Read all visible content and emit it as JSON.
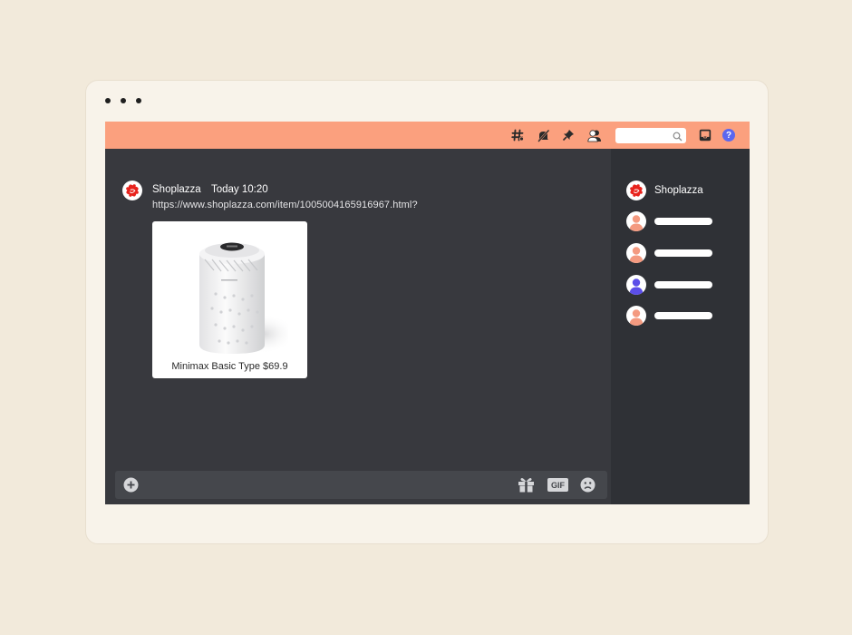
{
  "toolbar": {
    "icons": [
      "hashtag-icon",
      "mute-icon",
      "pin-icon",
      "members-icon",
      "search-icon",
      "inbox-icon",
      "help-icon"
    ],
    "search": {
      "placeholder": ""
    },
    "help_label": "?"
  },
  "message": {
    "author": "Shoplazza",
    "time": "Today 10:20",
    "link": "https://www.shoplazza.com/item/1005004165916967.html?",
    "card": {
      "title": "Minimax Basic Type $69.9",
      "image": "air-purifier-product-image"
    }
  },
  "composer": {
    "icons": [
      "add-icon",
      "gift-icon",
      "gif-icon",
      "emoji-icon"
    ],
    "gif_label": "GIF"
  },
  "sidebar": {
    "members": [
      {
        "name": "Shoplazza",
        "avatar": "shoplazza-logo",
        "color": "#e8231d"
      },
      {
        "name": "",
        "avatar": "user-avatar",
        "color": "#f49a80"
      },
      {
        "name": "",
        "avatar": "user-avatar",
        "color": "#f49a80"
      },
      {
        "name": "",
        "avatar": "user-avatar",
        "color": "#5b4ee8"
      },
      {
        "name": "",
        "avatar": "user-avatar",
        "color": "#f49a80"
      }
    ]
  },
  "colors": {
    "page_bg": "#f2eadb",
    "window_bg": "#f8f3ea",
    "topbar": "#fba07e",
    "main_bg": "#38393e",
    "sidebar_bg": "#2f3136",
    "accent_blue": "#5b67f0",
    "brand_red": "#e8231d"
  }
}
